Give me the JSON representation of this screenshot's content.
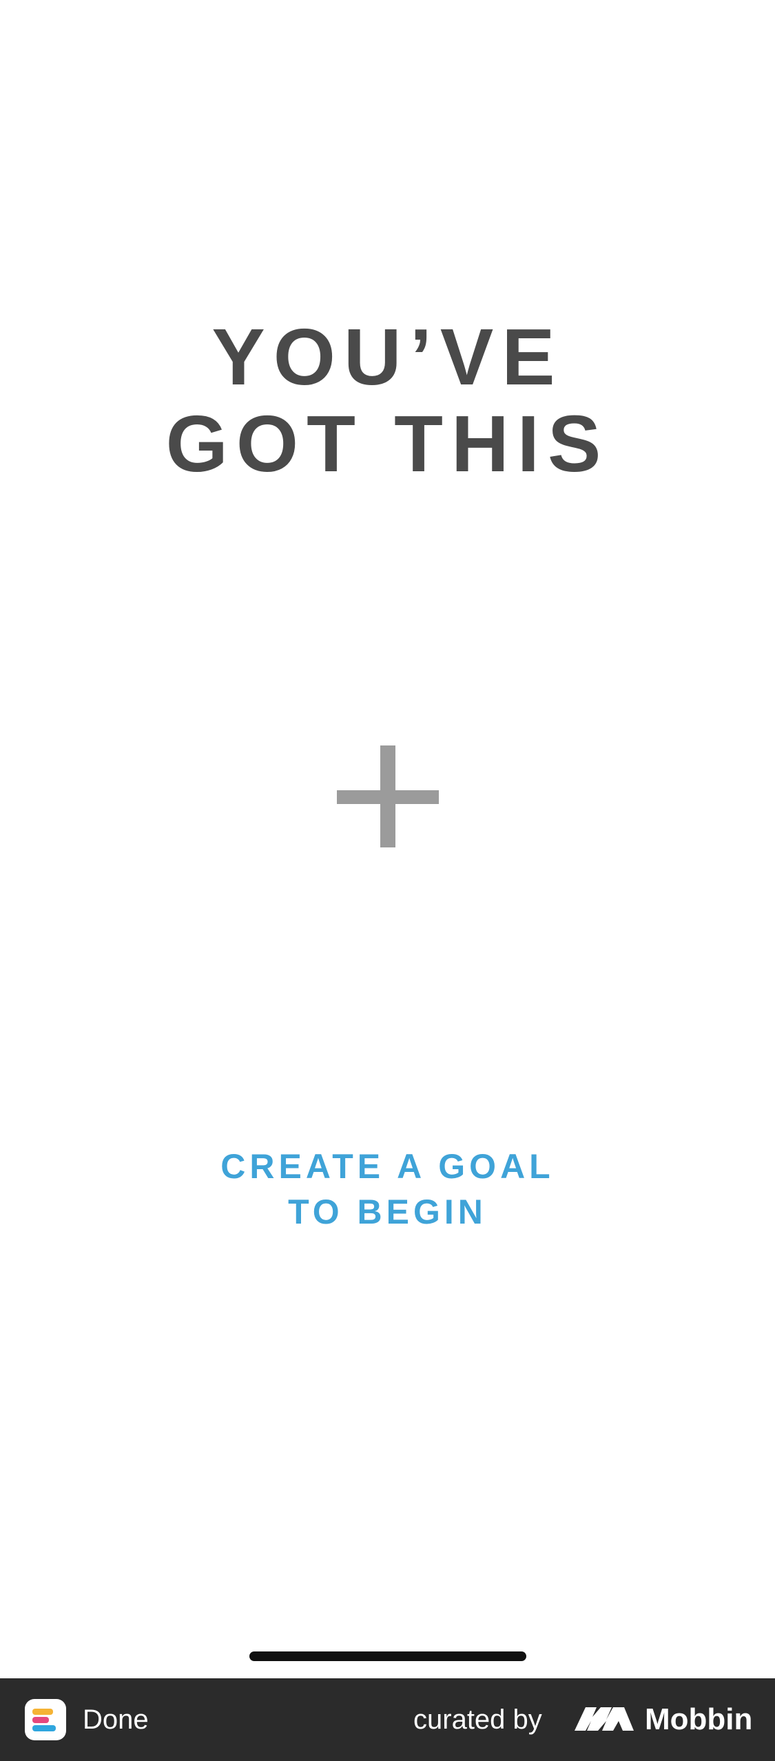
{
  "headline": {
    "line1": "YOU’VE",
    "line2": "GOT THIS"
  },
  "add_goal": {
    "icon": "plus-icon"
  },
  "cta": {
    "line1": "CREATE A GOAL",
    "line2": "TO BEGIN"
  },
  "footer": {
    "app_name": "Done",
    "curated_label": "curated by",
    "brand_name": "Mobbin"
  },
  "colors": {
    "headline": "#4a4a4a",
    "plus": "#9b9b9b",
    "cta": "#3fa3d8",
    "footer_bg": "#2b2b2b"
  }
}
